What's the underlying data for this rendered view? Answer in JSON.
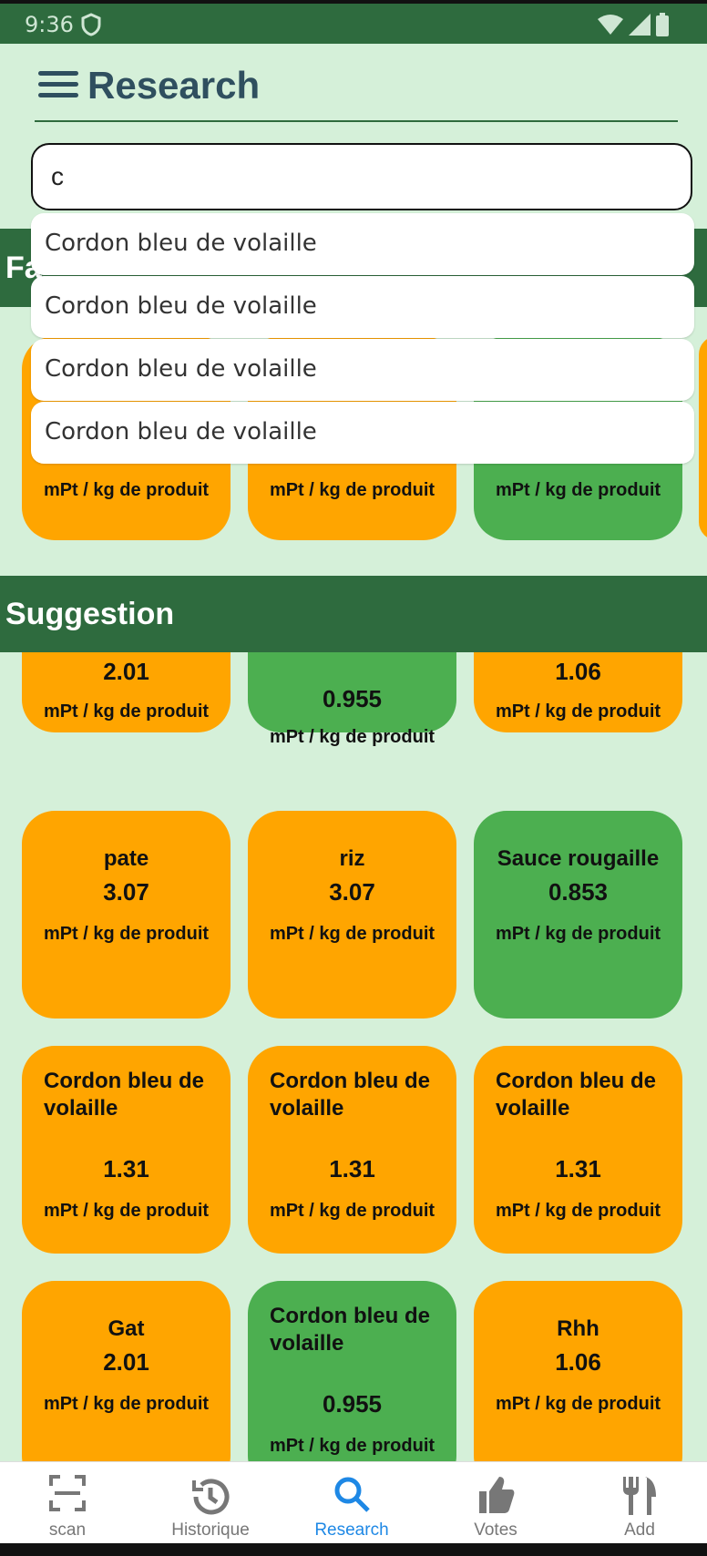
{
  "status": {
    "time": "9:36"
  },
  "header": {
    "title": "Research"
  },
  "search": {
    "value": "c",
    "placeholder": ""
  },
  "autocomplete": [
    "Cordon bleu de volaille",
    "Cordon bleu de volaille",
    "Cordon bleu de volaille",
    "Cordon bleu de volaille"
  ],
  "favoris": {
    "title_visible": "Fa",
    "unit": "mPt / kg de produit"
  },
  "suggestion": {
    "title": "Suggestion"
  },
  "unit_label": "mPt / kg de produit",
  "cards_partial": [
    {
      "value": "2.01",
      "color": "#ffa500"
    },
    {
      "value": "0.955",
      "color": "#4caf50"
    },
    {
      "value": "1.06",
      "color": "#ffa500"
    }
  ],
  "cards": [
    {
      "name": "pate",
      "value": "3.07",
      "color": "#ffa500"
    },
    {
      "name": "riz",
      "value": "3.07",
      "color": "#ffa500"
    },
    {
      "name": "Sauce rougaille",
      "value": "0.853",
      "color": "#4caf50"
    },
    {
      "name": "Cordon bleu de volaille",
      "value": "1.31",
      "color": "#ffa500"
    },
    {
      "name": "Cordon bleu de volaille",
      "value": "1.31",
      "color": "#ffa500"
    },
    {
      "name": "Cordon bleu de volaille",
      "value": "1.31",
      "color": "#ffa500"
    },
    {
      "name": "Gat",
      "value": "2.01",
      "color": "#ffa500"
    },
    {
      "name": "Cordon bleu de volaille",
      "value": "0.955",
      "color": "#4caf50"
    },
    {
      "name": "Rhh",
      "value": "1.06",
      "color": "#ffa500"
    }
  ],
  "nav": [
    {
      "label": "scan",
      "icon": "scan-icon"
    },
    {
      "label": "Historique",
      "icon": "history-icon"
    },
    {
      "label": "Research",
      "icon": "search-icon",
      "active": true
    },
    {
      "label": "Votes",
      "icon": "thumbs-up-icon"
    },
    {
      "label": "Add",
      "icon": "fork-knife-icon"
    }
  ],
  "colors": {
    "primary": "#2e6b3e",
    "background": "#d5f0d9",
    "orange": "#ffa500",
    "green": "#4caf50",
    "active": "#1e88e5"
  }
}
